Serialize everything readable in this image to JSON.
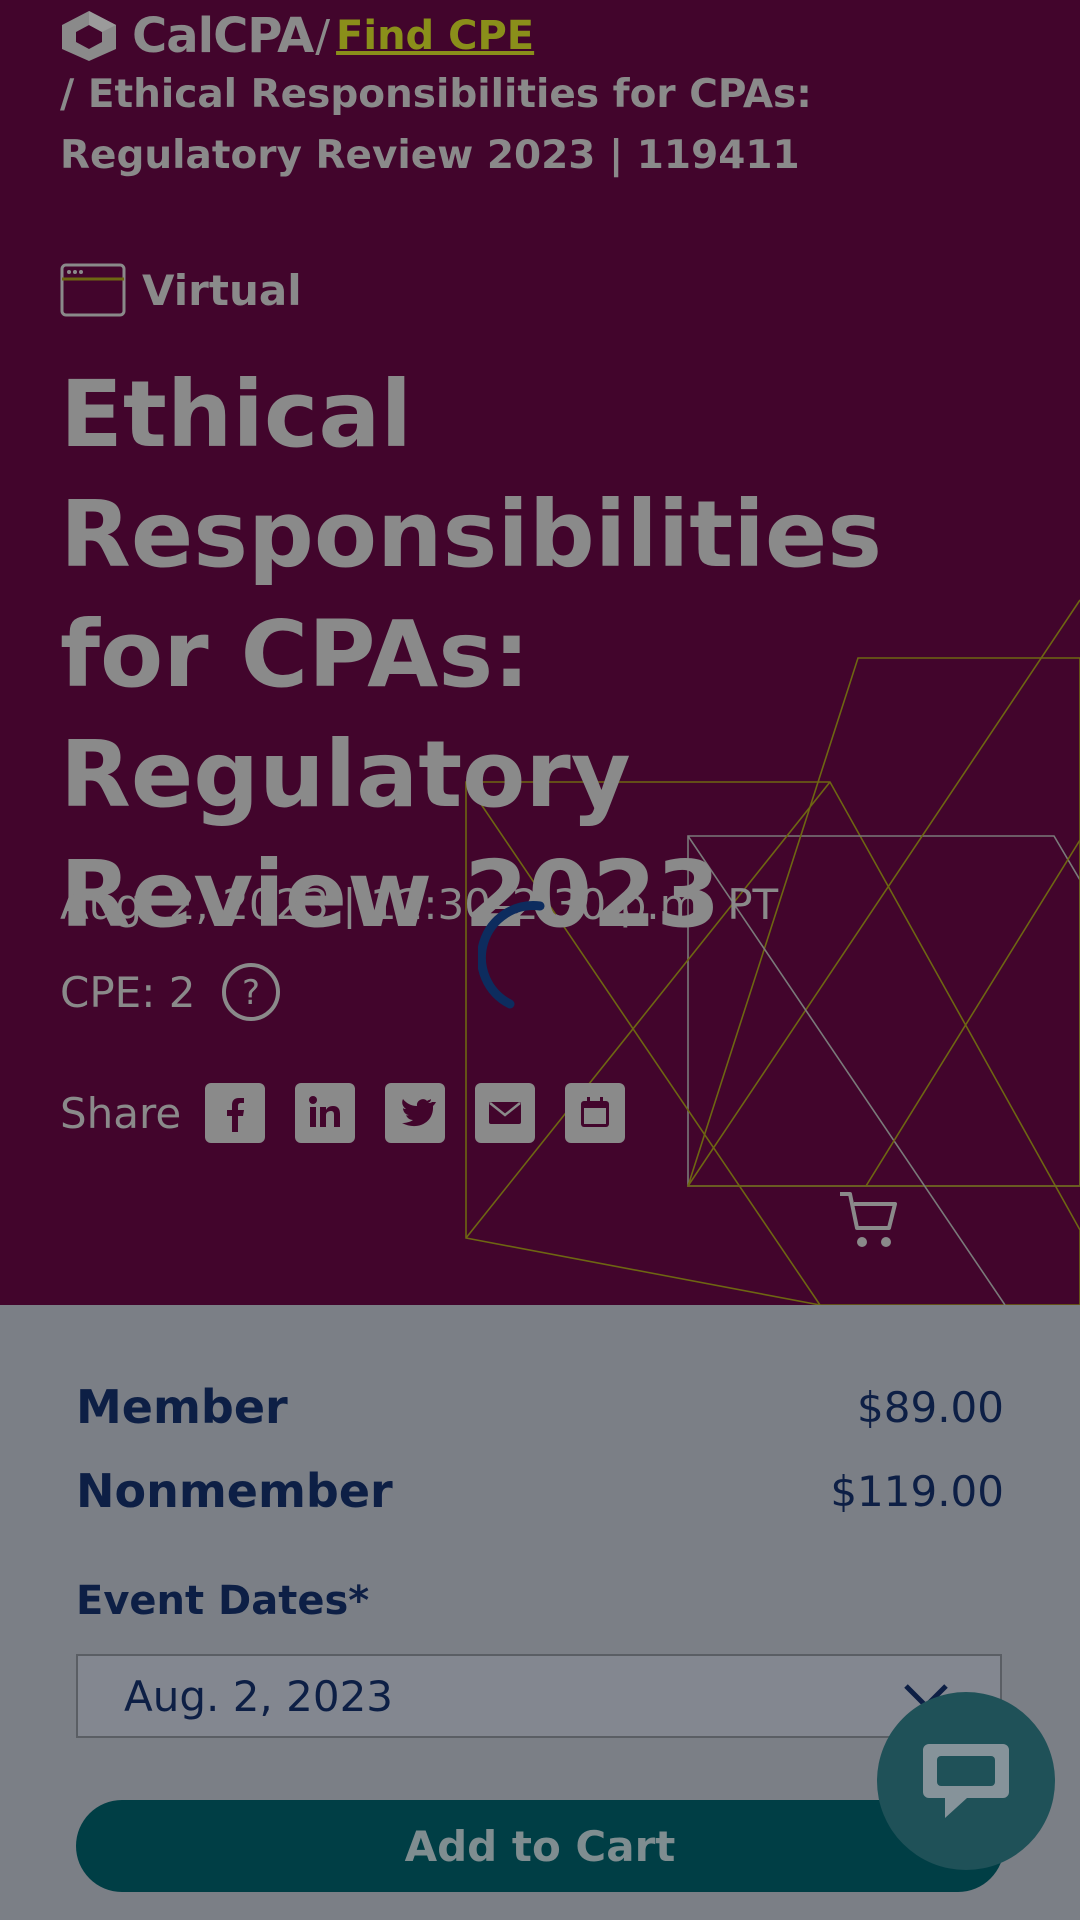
{
  "header": {
    "logo_text": "CalCPA",
    "breadcrumb_separator": "/",
    "breadcrumb_link": "Find CPE",
    "breadcrumb_current": "/ Ethical Responsibilities for CPAs: Regulatory Review 2023 | 119411"
  },
  "event": {
    "format_icon": "browser-window-icon",
    "format": "Virtual",
    "title": "Ethical Responsibilities for CPAs: Regulatory Review 2023",
    "datetime": "Aug. 2, 2023 | 12:30–2:30 p.m. PT",
    "cpe": "CPE: 2",
    "help_icon": "question-circle-icon"
  },
  "share": {
    "label": "Share",
    "buttons": [
      "facebook-icon",
      "linkedin-icon",
      "twitter-icon",
      "email-icon",
      "calendar-icon"
    ]
  },
  "pricing": {
    "member_label": "Member",
    "member_price": "$89.00",
    "nonmember_label": "Nonmember",
    "nonmember_price": "$119.00"
  },
  "registration": {
    "dates_label": "Event Dates*",
    "selected_date": "Aug. 2, 2023",
    "add_to_cart": "Add to Cart"
  },
  "colors": {
    "hero_bg": "#42052c",
    "overlay_text": "#8a8a8a",
    "link": "#8a8f1a",
    "navy": "#0d1f45",
    "button_teal": "#003e45",
    "chat": "#1f5158"
  }
}
